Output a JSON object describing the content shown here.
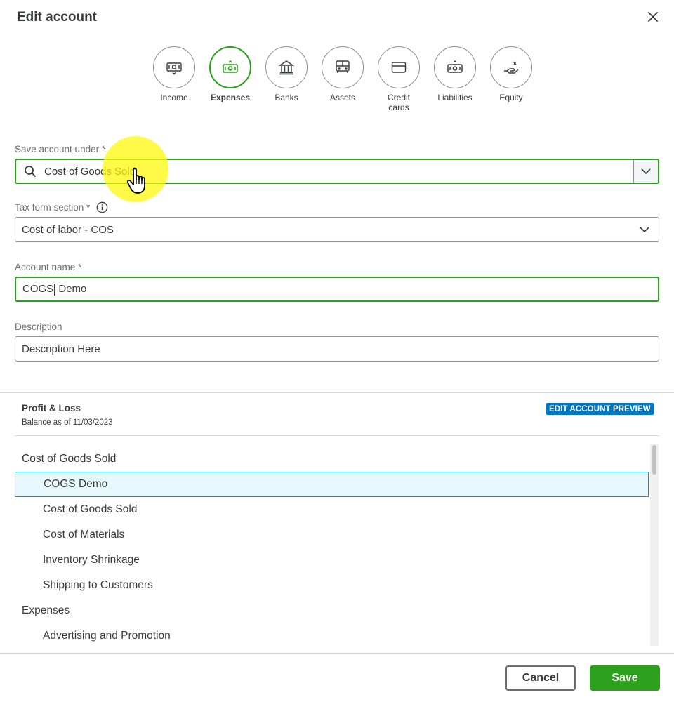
{
  "dialog": {
    "title": "Edit account"
  },
  "account_types": [
    {
      "label": "Income",
      "icon": "money-icon",
      "active": false
    },
    {
      "label": "Expenses",
      "icon": "money-out-icon",
      "active": true
    },
    {
      "label": "Banks",
      "icon": "bank-icon",
      "active": false
    },
    {
      "label": "Assets",
      "icon": "truck-icon",
      "active": false
    },
    {
      "label": "Credit cards",
      "icon": "credit-card-icon",
      "active": false
    },
    {
      "label": "Liabilities",
      "icon": "money-icon",
      "active": false
    },
    {
      "label": "Equity",
      "icon": "hand-money-icon",
      "active": false
    }
  ],
  "form": {
    "save_under": {
      "label": "Save account under *",
      "value": "Cost of Goods Sold"
    },
    "tax_form": {
      "label": "Tax form section *",
      "value": "Cost of labor - COS"
    },
    "account_name": {
      "label": "Account name *",
      "value_before_caret": "COGS",
      "value_after_caret": " Demo"
    },
    "description": {
      "label": "Description",
      "value": "Description Here"
    }
  },
  "preview": {
    "title": "Profit & Loss",
    "subtitle": "Balance as of 11/03/2023",
    "badge": "EDIT ACCOUNT PREVIEW",
    "rows": [
      {
        "label": "Cost of Goods Sold",
        "level": 0,
        "selected": false
      },
      {
        "label": "COGS Demo",
        "level": 1,
        "selected": true
      },
      {
        "label": "Cost of Goods Sold",
        "level": 1,
        "selected": false
      },
      {
        "label": "Cost of Materials",
        "level": 1,
        "selected": false
      },
      {
        "label": "Inventory Shrinkage",
        "level": 1,
        "selected": false
      },
      {
        "label": "Shipping to Customers",
        "level": 1,
        "selected": false
      },
      {
        "label": "Expenses",
        "level": 0,
        "selected": false
      },
      {
        "label": "Advertising and Promotion",
        "level": 1,
        "selected": false
      }
    ]
  },
  "footer": {
    "cancel_label": "Cancel",
    "save_label": "Save"
  },
  "colors": {
    "accent": "#2ca01c",
    "badge": "#0077c5",
    "selected_row": "#e6f8fc",
    "text": "#393a3d"
  }
}
